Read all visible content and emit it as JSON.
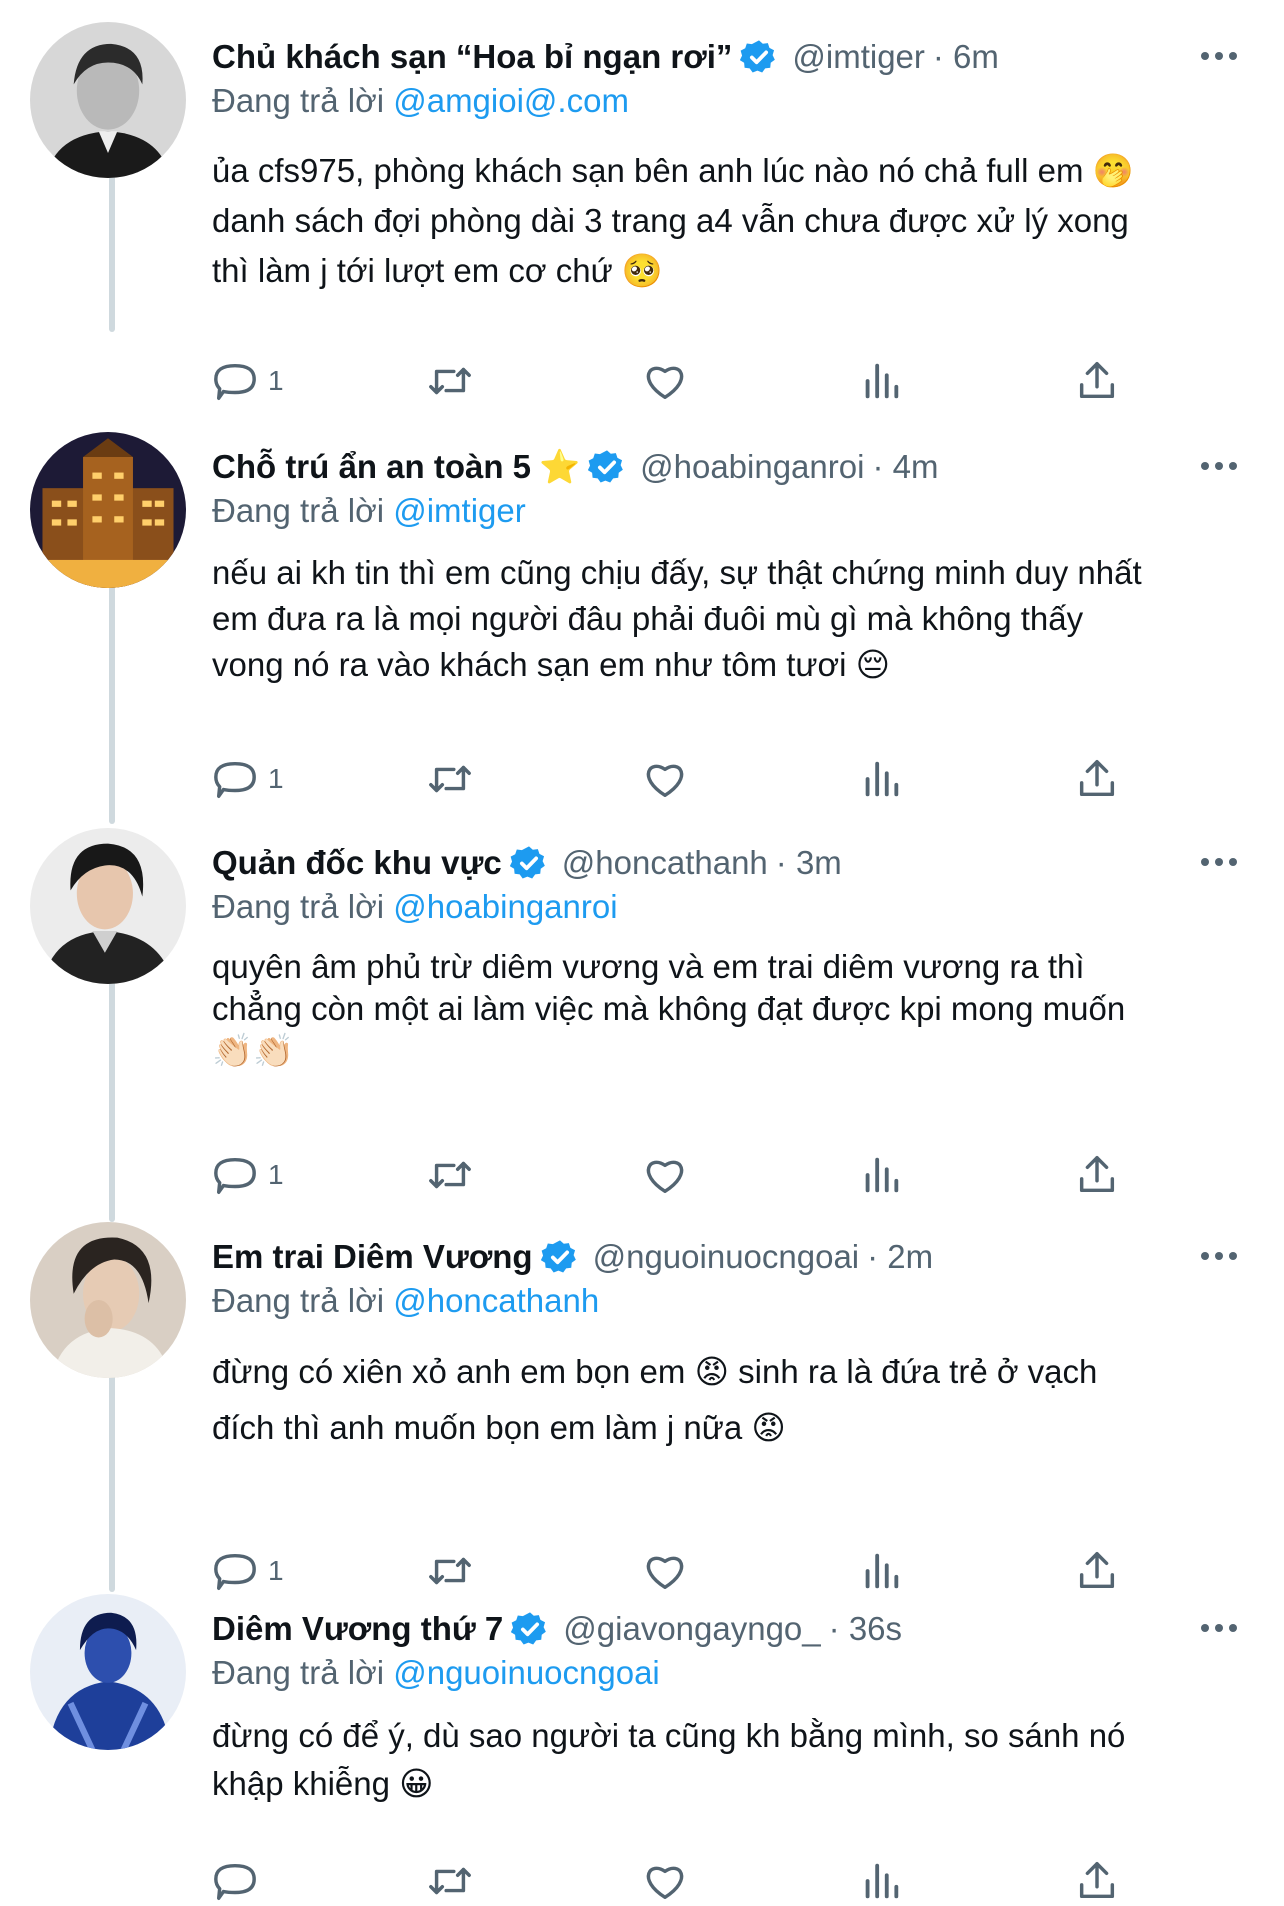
{
  "reply_prefix": "Đang trả lời",
  "colors": {
    "accent": "#1d9bf0",
    "secondary": "#536471",
    "text": "#0f1419",
    "thread_line": "#cfd9de"
  },
  "icons": {
    "verified": "verified-badge-icon",
    "more": "more-options-icon",
    "reply": "reply-icon",
    "retweet": "retweet-icon",
    "like": "like-icon",
    "views": "views-icon",
    "share": "share-icon"
  },
  "tweets": [
    {
      "name": "Chủ khách sạn “Hoa bỉ ngạn rơi”",
      "handle": "@imtiger",
      "time": "· 6m",
      "reply_to": "@amgioi@.com",
      "lines": [
        "ủa cfs975, phòng khách sạn bên anh lúc nào nó chả full em",
        "danh sách đợi phòng dài 3 trang a4 vẫn chưa được xử lý xong",
        "thì làm j tới lượt em cơ chứ"
      ],
      "emojis": [
        "🤭",
        "🥺"
      ],
      "reply_count": "1"
    },
    {
      "name": "Chỗ trú ẩn an toàn 5",
      "name_emoji": "⭐",
      "handle": "@hoabinganroi",
      "time": "· 4m",
      "reply_to": "@imtiger",
      "lines": [
        "nếu ai kh tin thì em cũng chịu đấy, sự thật chứng minh duy nhất",
        "em đưa ra là mọi người đâu phải đuôi mù gì mà không thấy",
        "vong nó ra vào khách sạn em như tôm tươi"
      ],
      "emojis": [
        "😔"
      ],
      "reply_count": "1"
    },
    {
      "name": "Quản đốc khu vực",
      "handle": "@honcathanh",
      "time": "· 3m",
      "reply_to": "@hoabinganroi",
      "lines": [
        "quyên âm phủ trừ diêm vương và em trai diêm vương ra thì",
        "chẳng còn một ai làm việc mà không đạt được kpi mong muốn"
      ],
      "emojis": [
        "👏🏻",
        "👏🏻"
      ],
      "reply_count": "1"
    },
    {
      "name": "Em trai Diêm Vương",
      "handle": "@nguoinuocngoai",
      "time": "· 2m",
      "reply_to": "@honcathanh",
      "lines": [
        "đừng có xiên xỏ anh em bọn em",
        "sinh ra là đứa trẻ ở vạch",
        "đích thì anh muốn bọn em làm j nữa"
      ],
      "emojis": [
        "😡",
        "😡"
      ],
      "reply_count": "1"
    },
    {
      "name": "Diêm Vương thứ 7",
      "handle": "@giavongayngo_",
      "time": "· 36s",
      "reply_to": "@nguoinuocngoai",
      "lines": [
        "đừng có để ý, dù sao người ta cũng kh bằng mình, so sánh nó",
        "khập khiễng"
      ],
      "emojis": [
        "😀"
      ],
      "reply_count": ""
    }
  ]
}
